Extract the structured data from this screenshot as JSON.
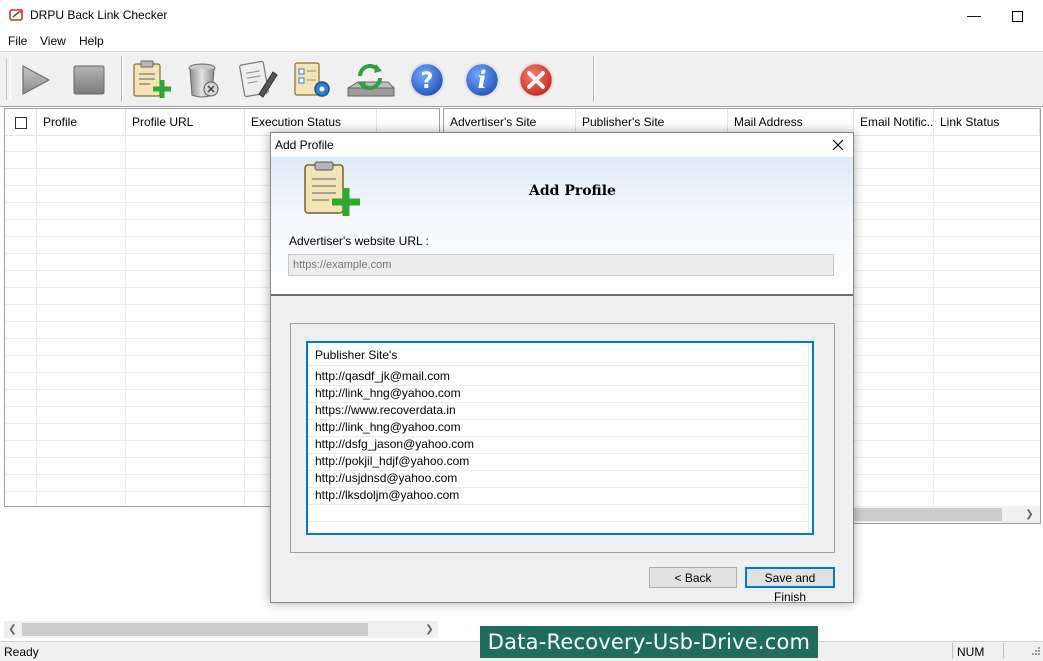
{
  "window": {
    "title": "DRPU Back Link Checker",
    "minimize_glyph": "—",
    "maximize_glyph": "☐"
  },
  "menu": [
    "File",
    "View",
    "Help"
  ],
  "toolbar": {
    "icons": [
      "play-icon",
      "stop-icon",
      "add-profile-icon",
      "delete-profile-icon",
      "edit-profile-icon",
      "settings-icon",
      "refresh-icon",
      "help-icon",
      "info-icon",
      "exit-icon"
    ]
  },
  "left_table": {
    "columns": [
      "Profile",
      "Profile URL",
      "Execution Status"
    ]
  },
  "right_table": {
    "columns": [
      "Advertiser's Site",
      "Publisher's Site",
      "Mail Address",
      "Email Notific...",
      "Link Status"
    ]
  },
  "status": {
    "text": "Ready",
    "num": "NUM"
  },
  "dialog": {
    "title": "Add Profile",
    "heading": "Add Profile",
    "url_label": "Advertiser's website URL :",
    "url_placeholder": "https://example.com",
    "publisher_header": "Publisher Site's",
    "publisher_sites": [
      "http://qasdf_jk@mail.com",
      "http://link_hng@yahoo.com",
      "https://www.recoverdata.in",
      "http://link_hng@yahoo.com",
      "http://dsfg_jason@yahoo.com",
      "http://pokjil_hdjf@yahoo.com",
      "http://usjdnsd@yahoo.com",
      "http://lksdoljm@yahoo.com"
    ],
    "back_label": "< Back",
    "save_label": "Save and Finish"
  },
  "watermark": "Data-Recovery-Usb-Drive.com",
  "colors": {
    "accent": "#0078d7",
    "watermark_bg": "#1f6e5d",
    "help_blue": "#1e5fd0",
    "exit_red": "#d93025"
  }
}
